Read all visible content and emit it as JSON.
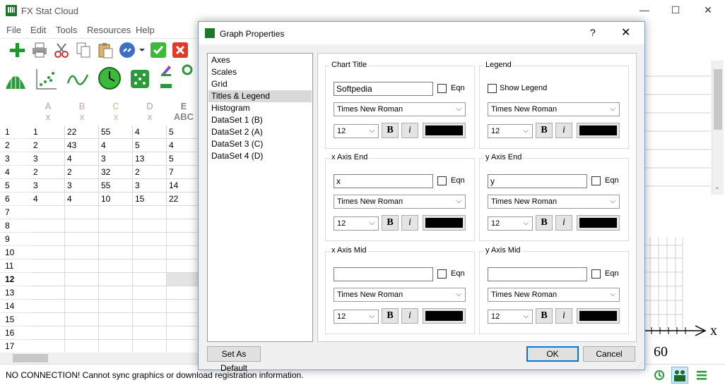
{
  "app": {
    "title": "FX Stat Cloud"
  },
  "window_controls": {
    "minimize": "—",
    "maximize": "☐",
    "close": "✕"
  },
  "menu": [
    "File",
    "Edit",
    "Tools",
    "Resources",
    "Help"
  ],
  "sheet": {
    "columns": [
      {
        "letter": "A",
        "type": "x"
      },
      {
        "letter": "B",
        "type": "x"
      },
      {
        "letter": "C",
        "type": "x"
      },
      {
        "letter": "D",
        "type": "x"
      },
      {
        "letter": "E",
        "type": "ABC"
      }
    ],
    "rows": [
      "1",
      "2",
      "3",
      "4",
      "5",
      "6",
      "7",
      "8",
      "9",
      "10",
      "11",
      "12",
      "13",
      "14",
      "15",
      "16",
      "17"
    ],
    "data": [
      [
        "1",
        "22",
        "55",
        "4",
        "5"
      ],
      [
        "2",
        "43",
        "4",
        "5",
        "4"
      ],
      [
        "3",
        "4",
        "3",
        "13",
        "5"
      ],
      [
        "2",
        "2",
        "32",
        "2",
        "7"
      ],
      [
        "3",
        "3",
        "55",
        "3",
        "14"
      ],
      [
        "4",
        "4",
        "10",
        "15",
        "22"
      ]
    ]
  },
  "background_axis": {
    "x_label": "x",
    "tick_60": "60"
  },
  "status": {
    "message": "NO CONNECTION! Cannot sync graphics or download registration information."
  },
  "dialog": {
    "title": "Graph Properties",
    "help": "?",
    "close": "✕",
    "nav": [
      "Axes",
      "Scales",
      "Grid",
      "Titles & Legend",
      "Histogram",
      "DataSet 1 (B)",
      "DataSet 2 (A)",
      "DataSet 3 (C)",
      "DataSet 4 (D)"
    ],
    "selected_nav": "Titles & Legend",
    "groups": {
      "chart_title": {
        "label": "Chart Title",
        "text": "Softpedia",
        "eqn": "Eqn",
        "font": "Times New Roman",
        "size": "12"
      },
      "legend": {
        "label": "Legend",
        "show_legend": "Show Legend",
        "font": "Times New Roman",
        "size": "12"
      },
      "x_axis_end": {
        "label": "x Axis End",
        "text": "x",
        "eqn": "Eqn",
        "font": "Times New Roman",
        "size": "12"
      },
      "y_axis_end": {
        "label": "y Axis End",
        "text": "y",
        "eqn": "Eqn",
        "font": "Times New Roman",
        "size": "12"
      },
      "x_axis_mid": {
        "label": "x Axis Mid",
        "text": "",
        "eqn": "Eqn",
        "font": "Times New Roman",
        "size": "12"
      },
      "y_axis_mid": {
        "label": "y Axis Mid",
        "text": "",
        "eqn": "Eqn",
        "font": "Times New Roman",
        "size": "12"
      }
    },
    "bold": "B",
    "italic": "i",
    "buttons": {
      "default": "Set As Default",
      "ok": "OK",
      "cancel": "Cancel"
    }
  },
  "colors": {
    "accent": "#0078d7",
    "app_green": "#1a7a2a",
    "swatch": "#000000"
  }
}
